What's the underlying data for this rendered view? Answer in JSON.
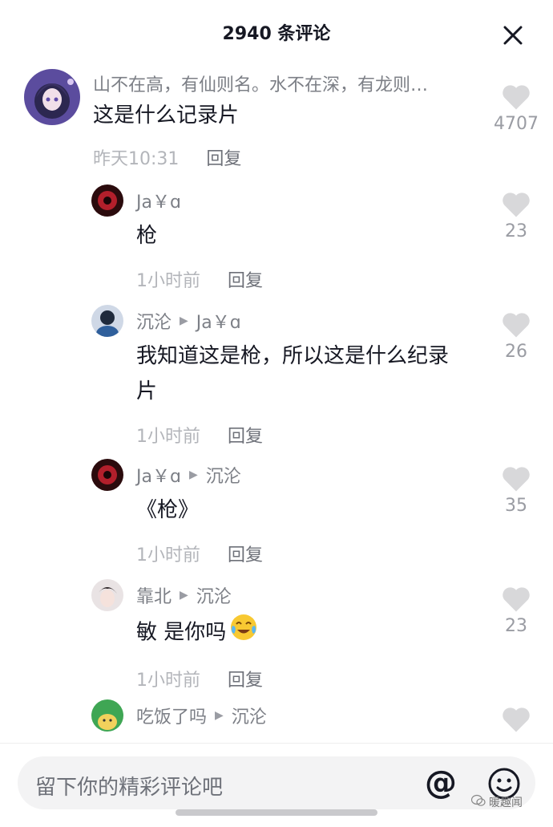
{
  "header": {
    "title": "2940 条评论",
    "close_icon": "close-icon"
  },
  "comments": [
    {
      "username": "山不在高，有仙则名。水不在深，有龙则…",
      "text": "这是什么记录片",
      "time": "昨天10:31",
      "reply_label": "回复",
      "likes": "4707"
    },
    {
      "username": "Ja￥ɑ",
      "text": "枪",
      "time": "1小时前",
      "reply_label": "回复",
      "likes": "23"
    },
    {
      "username": "沉沦",
      "reply_to": "Ja￥ɑ",
      "text": "我知道这是枪，所以这是什么纪录",
      "text2": "片",
      "time": "1小时前",
      "reply_label": "回复",
      "likes": "26"
    },
    {
      "username": "Ja￥ɑ",
      "reply_to": "沉沦",
      "text": "《枪》",
      "time": "1小时前",
      "reply_label": "回复",
      "likes": "35"
    },
    {
      "username": "靠北",
      "reply_to": "沉沦",
      "text": "敏 是你吗",
      "emoji": "crying-laughing-emoji",
      "time": "1小时前",
      "reply_label": "回复",
      "likes": "23"
    },
    {
      "username": "吃饭了吗",
      "reply_to": "沉沦"
    }
  ],
  "input": {
    "placeholder": "留下你的精彩评论吧",
    "at_symbol": "@",
    "emoji_icon": "smiley-face-icon"
  },
  "watermark": {
    "text": "暖趣闻"
  },
  "colors": {
    "primary_text": "#161823",
    "secondary_text": "#7c7f86",
    "heart": "#d8d8da",
    "input_bg": "#f3f3f4"
  }
}
